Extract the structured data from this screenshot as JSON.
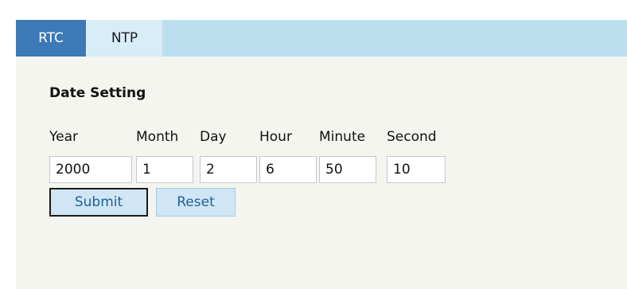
{
  "tabs": [
    {
      "label": "RTC",
      "active": true
    },
    {
      "label": "NTP",
      "active": false
    }
  ],
  "section": {
    "title": "Date Setting"
  },
  "fields": {
    "year": {
      "label": "Year",
      "value": "2000"
    },
    "month": {
      "label": "Month",
      "value": "1"
    },
    "day": {
      "label": "Day",
      "value": "2"
    },
    "hour": {
      "label": "Hour",
      "value": "6"
    },
    "minute": {
      "label": "Minute",
      "value": "50"
    },
    "second": {
      "label": "Second",
      "value": "10"
    }
  },
  "buttons": {
    "submit": "Submit",
    "reset": "Reset"
  },
  "colors": {
    "tab_bar": "#bcdff0",
    "active_tab": "#3c79b6",
    "inactive_tab": "#d8edf8",
    "panel_background": "#f4f5ee",
    "button_background": "#d0e6f4",
    "button_text": "#1e5f9c"
  }
}
